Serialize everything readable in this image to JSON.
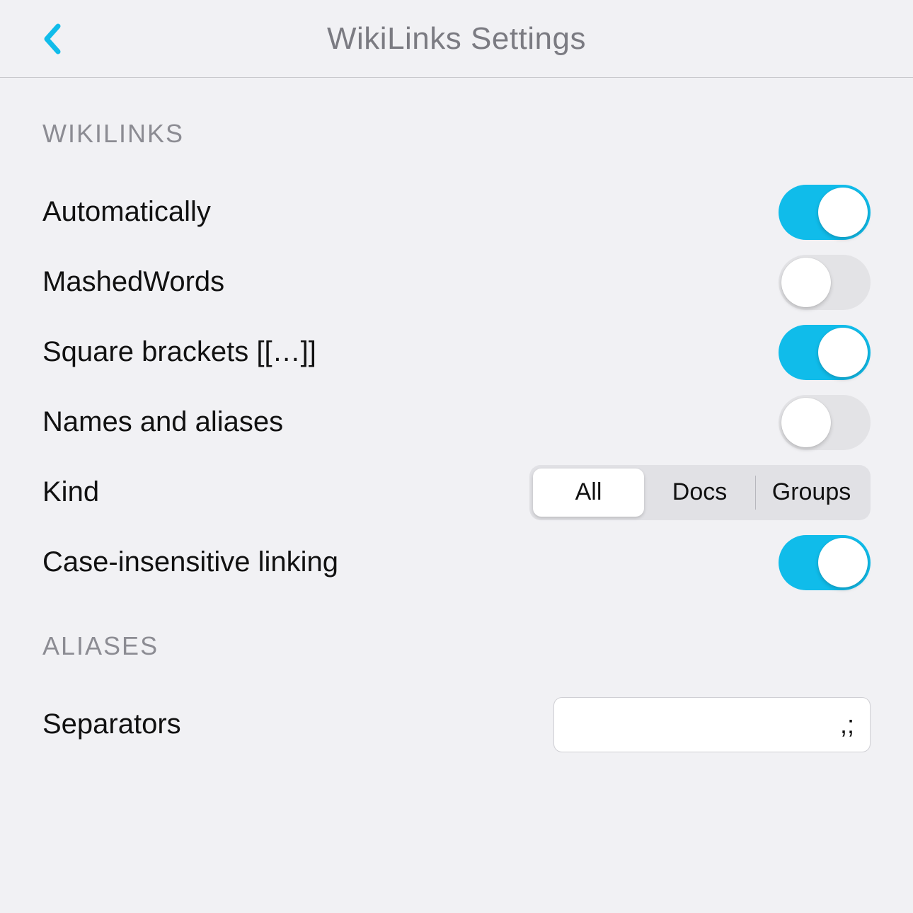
{
  "header": {
    "title": "WikiLinks Settings"
  },
  "colors": {
    "accent": "#10bcea",
    "bg": "#f1f1f4",
    "muted": "#8c8c93"
  },
  "sections": {
    "wikilinks": {
      "header": "WIKILINKS",
      "items": {
        "automatically": {
          "label": "Automatically",
          "value": true
        },
        "mashed_words": {
          "label": "MashedWords",
          "value": false
        },
        "square_brackets": {
          "label": "Square brackets [[…]]",
          "value": true
        },
        "names_aliases": {
          "label": "Names and aliases",
          "value": false
        },
        "kind": {
          "label": "Kind",
          "options": [
            "All",
            "Docs",
            "Groups"
          ],
          "selected": "All"
        },
        "case_insensitive": {
          "label": "Case-insensitive linking",
          "value": true
        }
      }
    },
    "aliases": {
      "header": "ALIASES",
      "items": {
        "separators": {
          "label": "Separators",
          "value": ",;"
        }
      }
    }
  }
}
